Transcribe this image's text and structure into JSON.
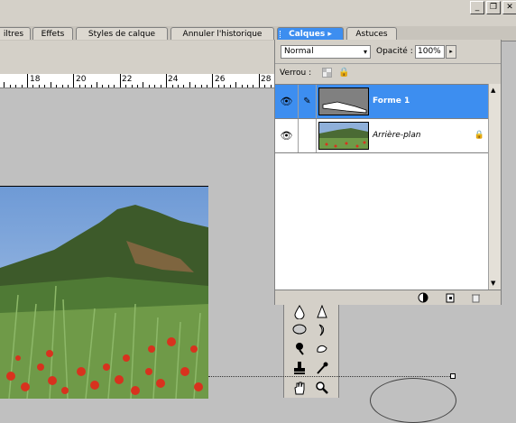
{
  "window": {
    "minimize_glyph": "_",
    "restore_glyph": "❐",
    "close_glyph": "✕"
  },
  "tabs": [
    {
      "label": "iltres"
    },
    {
      "label": "Effets"
    },
    {
      "label": "Styles de calque"
    },
    {
      "label": "Annuler l'historique"
    },
    {
      "label": "Calques",
      "arrow": "▸"
    },
    {
      "label": "Astuces"
    }
  ],
  "ruler": {
    "labels": [
      "18",
      "20",
      "22",
      "24",
      "26",
      "28"
    ]
  },
  "layers_panel": {
    "blend_mode": "Normal",
    "blend_arrow": "▾",
    "opacity_label": "Opacité :",
    "opacity_value": "100%",
    "opacity_button": "▸",
    "lock_label": "Verrou :",
    "layers": [
      {
        "name": "Forme 1",
        "selected": true,
        "visible": true,
        "link_icon": "brush-icon"
      },
      {
        "name": "Arrière-plan",
        "selected": false,
        "visible": true,
        "locked": true
      }
    ],
    "eye_glyph": "👁",
    "brush_glyph": "✎",
    "lock_glyph": "🔒",
    "scroll_up": "▲",
    "scroll_down": "▼",
    "bottom_icons": [
      "adjustment-icon",
      "new-layer-icon",
      "trash-icon"
    ]
  },
  "toolbox": {
    "tools": [
      "drop-icon",
      "sharpen-icon",
      "sponge-icon",
      "smudge-icon",
      "burn-icon",
      "dodge-icon",
      "stamp-icon",
      "eyedropper-icon",
      "hand-icon",
      "zoom-icon"
    ]
  },
  "colors": {
    "accent": "#3d8ef0",
    "panel": "#d4d0c8",
    "canvas": "#c0c0c0"
  }
}
